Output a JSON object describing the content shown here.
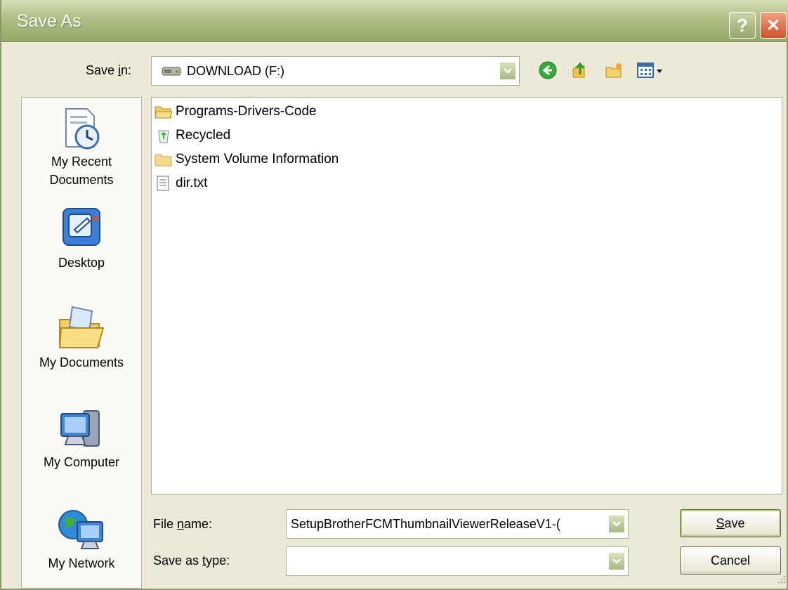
{
  "window": {
    "title": "Save As",
    "help_glyph": "?",
    "close_glyph": "✕"
  },
  "save_in": {
    "label_prefix": "Save ",
    "label_underlined": "i",
    "label_suffix": "n:",
    "value": "DOWNLOAD (F:)",
    "icon": "drive-icon"
  },
  "toolbar": {
    "icons": [
      "back-icon",
      "up-folder-icon",
      "new-folder-icon",
      "views-menu-icon"
    ]
  },
  "places": {
    "items": [
      {
        "label_line1": "My Recent",
        "label_line2": "Documents",
        "icon": "recent-documents-icon"
      },
      {
        "label_line1": "Desktop",
        "label_line2": "",
        "icon": "desktop-icon"
      },
      {
        "label_line1": "My Documents",
        "label_line2": "",
        "icon": "my-documents-icon"
      },
      {
        "label_line1": "My Computer",
        "label_line2": "",
        "icon": "my-computer-icon"
      },
      {
        "label_line1": "My Network",
        "label_line2": "",
        "icon": "my-network-icon"
      }
    ]
  },
  "files": {
    "items": [
      {
        "name": "Programs-Drivers-Code",
        "icon": "folder-open-icon"
      },
      {
        "name": "Recycled",
        "icon": "recycle-bin-icon"
      },
      {
        "name": "System Volume Information",
        "icon": "folder-icon"
      },
      {
        "name": "dir.txt",
        "icon": "text-file-icon"
      }
    ]
  },
  "file_name": {
    "label_prefix": "File ",
    "label_underlined": "n",
    "label_suffix": "ame:",
    "value": "SetupBrotherFCMThumbnailViewerReleaseV1-("
  },
  "save_as_type": {
    "label_prefix": "Save as ",
    "label_underlined": "t",
    "label_suffix": "ype:",
    "value": ""
  },
  "buttons": {
    "save_underlined": "S",
    "save_rest": "ave",
    "cancel": "Cancel"
  },
  "colors": {
    "title_bar": "#a2b476",
    "window_bg": "#ece9d8",
    "close_button": "#d0522c"
  }
}
